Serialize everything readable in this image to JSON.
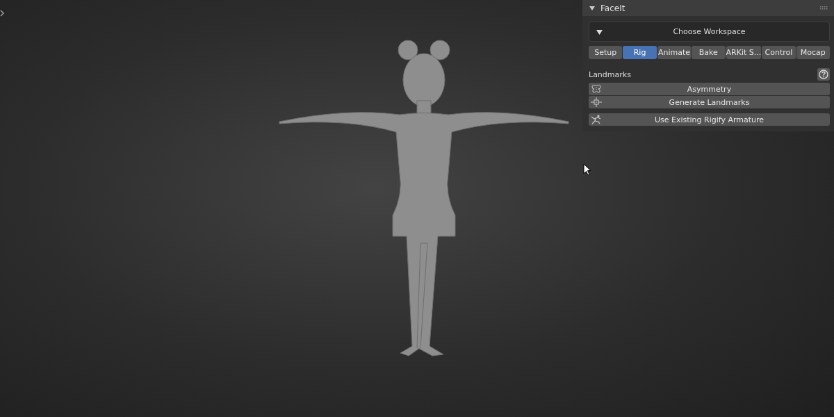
{
  "panel": {
    "title": "FaceIt",
    "expanded": true
  },
  "workspace_dropdown": {
    "label": "Choose Workspace"
  },
  "tabs": [
    {
      "label": "Setup",
      "selected": false
    },
    {
      "label": "Rig",
      "selected": true
    },
    {
      "label": "Animate",
      "selected": false
    },
    {
      "label": "Bake",
      "selected": false
    },
    {
      "label": "ARKit S...",
      "selected": false
    },
    {
      "label": "Control",
      "selected": false
    },
    {
      "label": "Mocap",
      "selected": false
    }
  ],
  "section": {
    "title": "Landmarks"
  },
  "button_groups": [
    [
      {
        "kind": "asymmetry",
        "label": "Asymmetry"
      },
      {
        "kind": "target",
        "label": "Generate Landmarks"
      }
    ],
    [
      {
        "kind": "armature",
        "label": "Use Existing Rigify Armature"
      }
    ]
  ]
}
